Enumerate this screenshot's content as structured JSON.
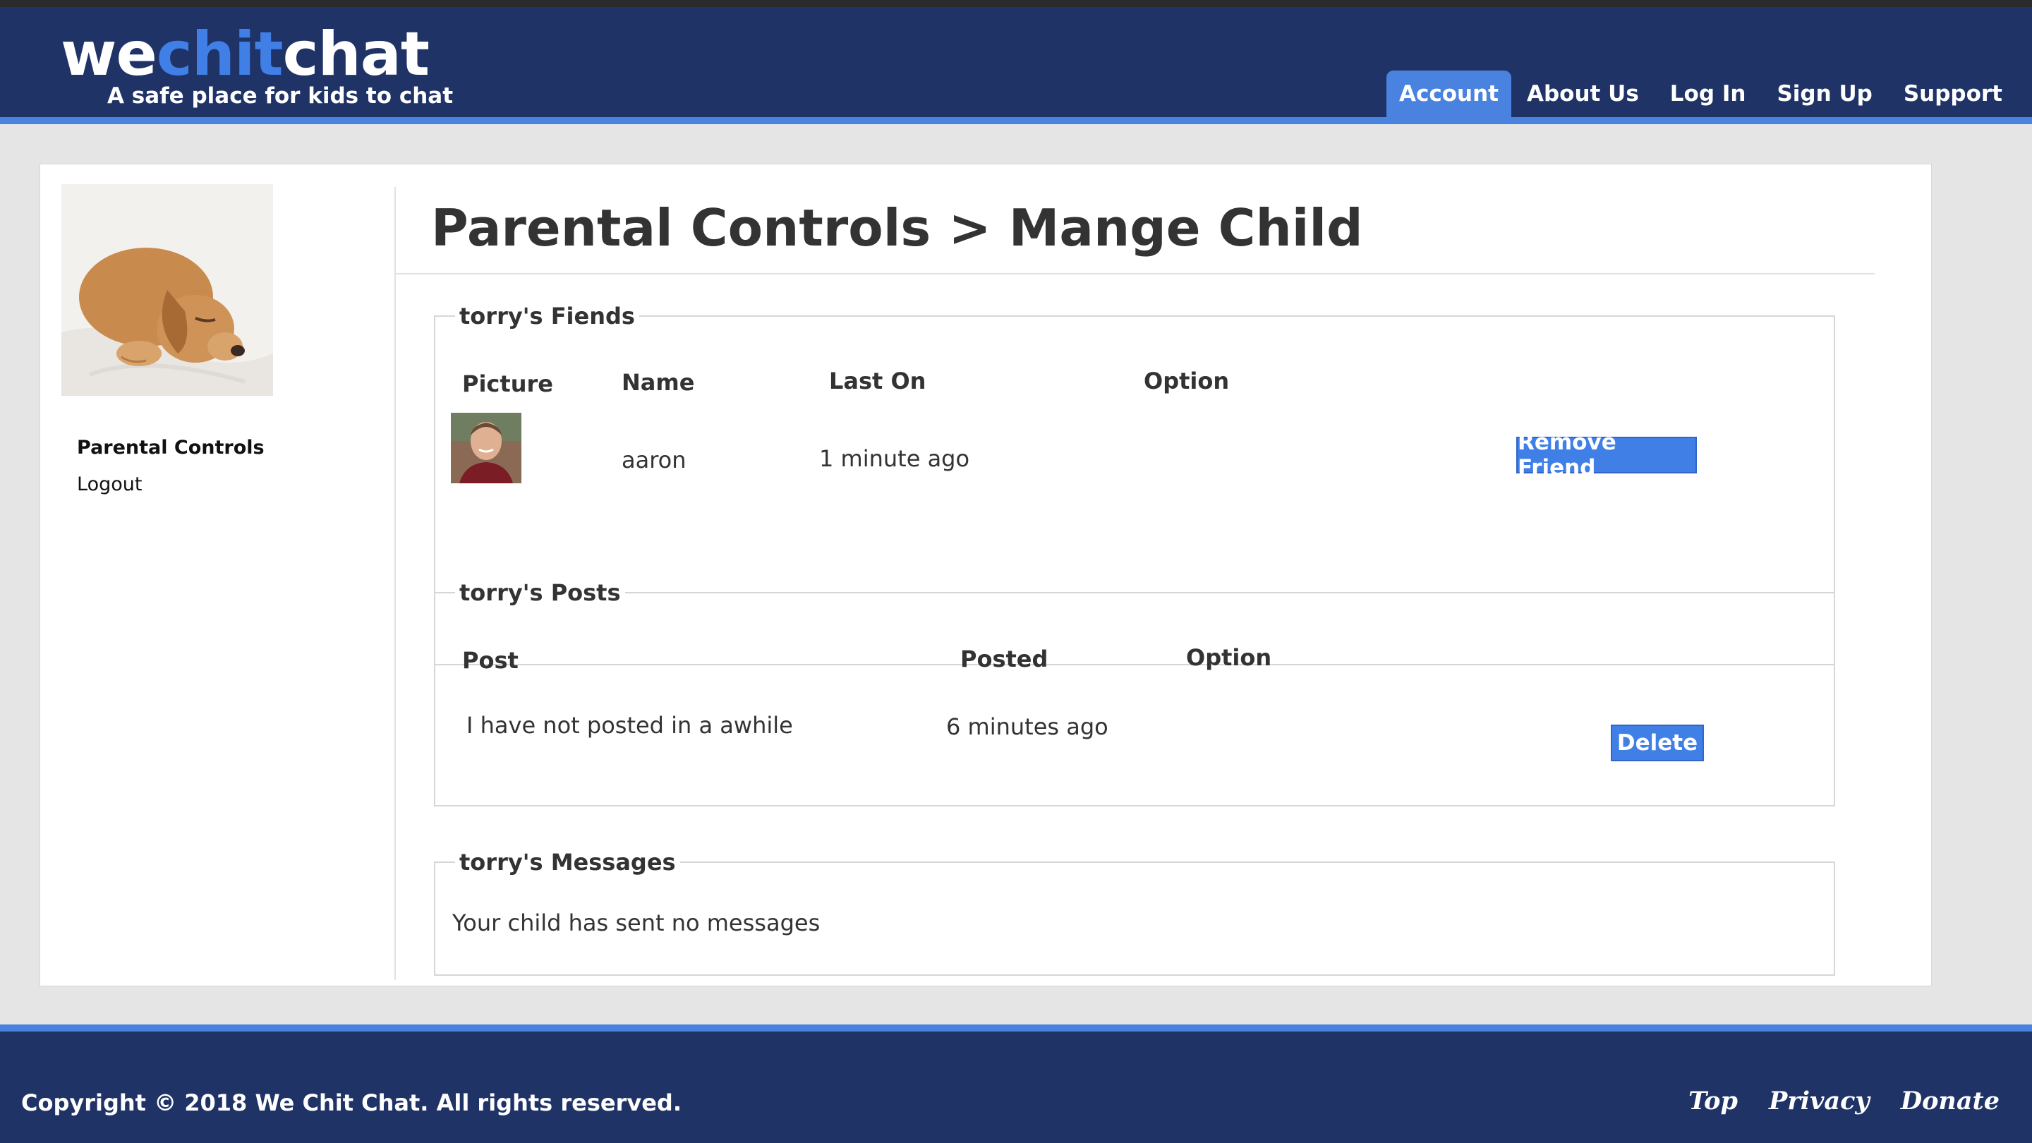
{
  "header": {
    "logo": [
      "we",
      "chit",
      "chat"
    ],
    "tagline": "A safe place for kids to chat",
    "nav": [
      "Account",
      "About Us",
      "Log In",
      "Sign Up",
      "Support"
    ],
    "active_nav": "Account"
  },
  "sidebar": {
    "links": [
      "Parental Controls",
      "Logout"
    ]
  },
  "page": {
    "title": "Parental Controls > Mange Child"
  },
  "friends": {
    "legend": "torry's Fiends",
    "headers": [
      "Picture",
      "Name",
      "Last On",
      "Option"
    ],
    "rows": [
      {
        "name": "aaron",
        "last_on": "1 minute ago",
        "button": "Remove Friend"
      }
    ]
  },
  "posts": {
    "legend": "torry's Posts",
    "headers": [
      "Post",
      "Posted",
      "Option"
    ],
    "rows": [
      {
        "post": "I have not posted in a awhile",
        "posted": "6 minutes ago",
        "button": "Delete"
      }
    ]
  },
  "messages": {
    "legend": "torry's Messages",
    "empty_text": "Your child has sent no messages"
  },
  "footer": {
    "copyright": "Copyright © 2018 We Chit Chat. All rights reserved.",
    "links": [
      "Top",
      "Privacy",
      "Donate"
    ]
  },
  "colors": {
    "navy": "#1f3366",
    "accent_blue": "#3f7fe6",
    "page_bg": "#e5e5e5"
  }
}
